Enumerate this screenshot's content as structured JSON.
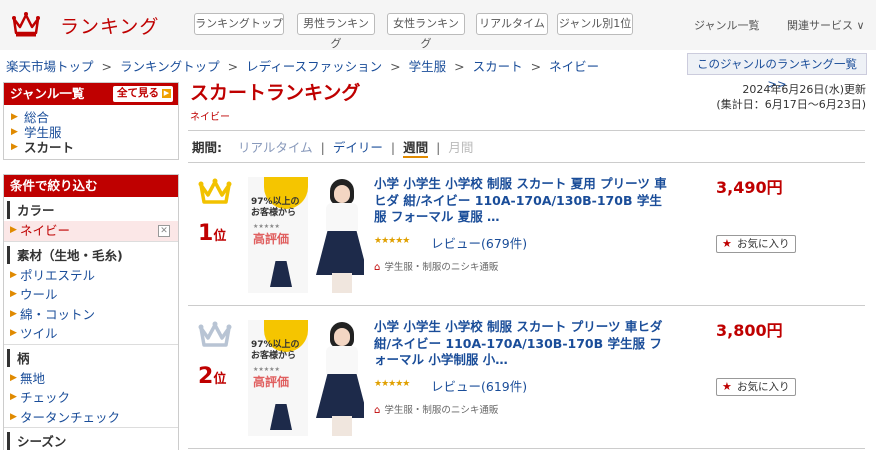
{
  "header": {
    "logo_text": "ランキング",
    "tabs": [
      {
        "label": "ランキングトップ"
      },
      {
        "label": "男性ランキング"
      },
      {
        "label": "女性ランキング"
      },
      {
        "label": "リアルタイム"
      },
      {
        "label": "ジャンル別1位"
      }
    ],
    "genre_list_link": "ジャンル一覧",
    "related_services": "関連サービス ∨"
  },
  "breadcrumb": {
    "items": [
      "楽天市場トップ",
      "ランキングトップ",
      "レディースファッション",
      "学生服",
      "スカート",
      "ネイビー"
    ],
    "separator": ">"
  },
  "genre_ranking_list_button": "このジャンルのランキング一覧 >>",
  "sidebar": {
    "genre_header": "ジャンル一覧",
    "see_all": "全て見る",
    "genre_items": [
      {
        "label": "総合"
      },
      {
        "label": "学生服"
      },
      {
        "label": "スカート"
      }
    ],
    "filter_header": "条件で絞り込む",
    "sections": [
      {
        "title": "カラー",
        "items": [
          {
            "label": "ネイビー",
            "selected": true
          }
        ]
      },
      {
        "title": "素材（生地・毛糸)",
        "items": [
          {
            "label": "ポリエステル"
          },
          {
            "label": "ウール"
          },
          {
            "label": "綿・コットン"
          },
          {
            "label": "ツイル"
          }
        ]
      },
      {
        "title": "柄",
        "items": [
          {
            "label": "無地"
          },
          {
            "label": "チェック"
          },
          {
            "label": "タータンチェック"
          }
        ]
      },
      {
        "title": "シーズン",
        "items": []
      }
    ]
  },
  "main": {
    "title": "スカートランキング",
    "subtitle": "ネイビー",
    "updated_line1": "2024年6月26日(水)更新",
    "updated_line2": "(集計日：6月17日～6月23日)",
    "period_label": "期間:",
    "period_options": [
      {
        "label": "リアルタイム"
      },
      {
        "label": "デイリー"
      },
      {
        "label": "週間"
      },
      {
        "label": "月間"
      }
    ]
  },
  "items": [
    {
      "rank": "1",
      "rank_suffix": "位",
      "crown_color": "#f2c200",
      "title": "小学 小学生 小学校 制服 スカート 夏用 プリーツ 車ヒダ 紺/ネイビー 110A-170A/130B-170B 学生服 フォーマル 夏服 …",
      "stars": "★★★★★",
      "rating": 4.5,
      "review": "レビュー(679件)",
      "shop": "学生服・制服のニシキ通販",
      "price": "3,490円",
      "fav_label": "お気に入り",
      "thumb_text1": "97%以上の",
      "thumb_text2": "お客様から",
      "thumb_text3": "高評価"
    },
    {
      "rank": "2",
      "rank_suffix": "位",
      "crown_color": "#b8c4d4",
      "title": "小学 小学生 小学校 制服 スカート プリーツ 車ヒダ 紺/ネイビー 110A-170A/130B-170B 学生服 フォーマル 小学制服 小…",
      "stars": "★★★★★",
      "rating": 4.5,
      "review": "レビュー(619件)",
      "shop": "学生服・制服のニシキ通販",
      "price": "3,800円",
      "fav_label": "お気に入り",
      "thumb_text1": "97%以上の",
      "thumb_text2": "お客様から",
      "thumb_text3": "高評価"
    }
  ]
}
